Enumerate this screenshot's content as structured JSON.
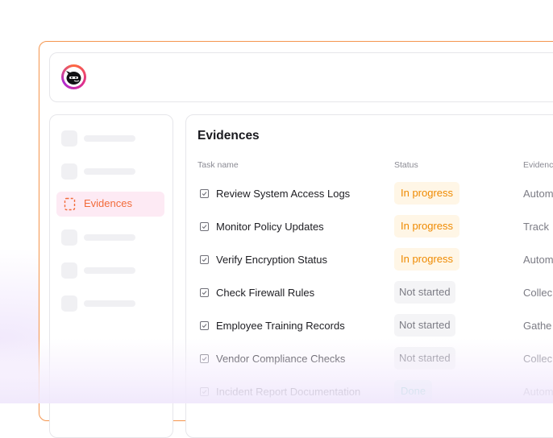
{
  "app": {
    "logo_icon": "ninja-mascot-icon"
  },
  "sidebar": {
    "active_item": {
      "label": "Evidences",
      "icon": "dashed-document-icon",
      "color": "#f26b3a"
    }
  },
  "panel": {
    "title": "Evidences",
    "columns": {
      "task": "Task name",
      "status": "Status",
      "evidence": "Evidenc"
    },
    "rows": [
      {
        "name": "Review System Access Logs",
        "status": "In progress",
        "status_kind": "progress",
        "evidence": "Autom"
      },
      {
        "name": "Monitor Policy Updates",
        "status": "In progress",
        "status_kind": "progress",
        "evidence": "Track"
      },
      {
        "name": "Verify Encryption Status",
        "status": "In progress",
        "status_kind": "progress",
        "evidence": "Autom"
      },
      {
        "name": "Check Firewall Rules",
        "status": "Not started",
        "status_kind": "notstarted",
        "evidence": "Collec"
      },
      {
        "name": "Employee Training Records",
        "status": "Not started",
        "status_kind": "notstarted",
        "evidence": "Gathe"
      },
      {
        "name": "Vendor Compliance Checks",
        "status": "Not started",
        "status_kind": "notstarted",
        "evidence": "Collec"
      },
      {
        "name": "Incident Report Documentation",
        "status": "Done",
        "status_kind": "done",
        "evidence": "Autom"
      }
    ]
  },
  "colors": {
    "accent": "#f59a56",
    "in_progress": "#ef8a00",
    "done": "#3bb8a4"
  }
}
